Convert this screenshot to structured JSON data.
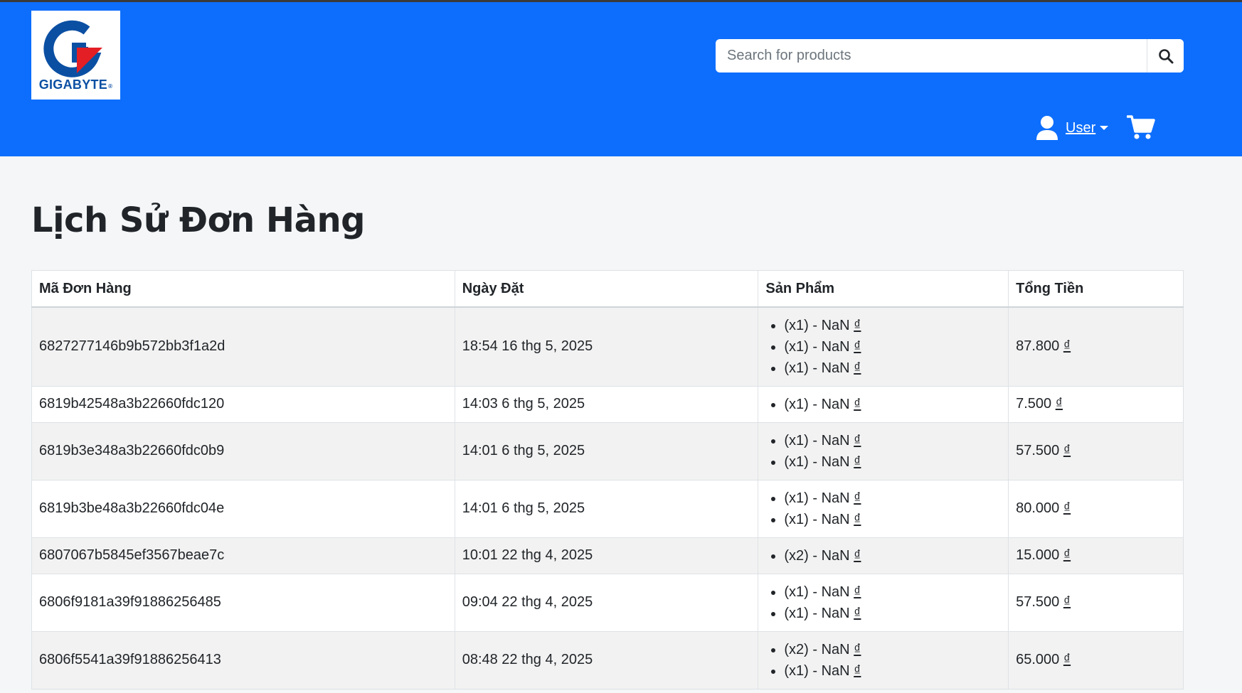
{
  "brand": {
    "logo_text": "GIGABYTE",
    "registered_mark": "®",
    "colors": {
      "header_bg": "#0d6efd",
      "logo_blue": "#0b4fa3",
      "logo_red": "#e31e24"
    }
  },
  "search": {
    "placeholder": "Search for products",
    "value": "",
    "button_icon": "search-icon"
  },
  "user_menu": {
    "icon": "user-icon",
    "label": "User",
    "caret_icon": "caret-down-icon"
  },
  "cart": {
    "icon": "shopping-cart-icon"
  },
  "page": {
    "title": "Lịch Sử Đơn Hàng"
  },
  "orders_table": {
    "headers": [
      "Mã Đơn Hàng",
      "Ngày Đặt",
      "Sản Phẩm",
      "Tổng Tiền"
    ],
    "currency_symbol": "₫",
    "rows": [
      {
        "id": "6827277146b9b572bb3f1a2d",
        "date": "18:54 16 thg 5, 2025",
        "items": [
          {
            "qty": "(x1) - NaN ",
            "price_symbol": "₫"
          },
          {
            "qty": "(x1) - NaN ",
            "price_symbol": "₫"
          },
          {
            "qty": "(x1) - NaN ",
            "price_symbol": "₫"
          }
        ],
        "total": "87.800 "
      },
      {
        "id": "6819b42548a3b22660fdc120",
        "date": "14:03 6 thg 5, 2025",
        "items": [
          {
            "qty": "(x1) - NaN ",
            "price_symbol": "₫"
          }
        ],
        "total": "7.500 "
      },
      {
        "id": "6819b3e348a3b22660fdc0b9",
        "date": "14:01 6 thg 5, 2025",
        "items": [
          {
            "qty": "(x1) - NaN ",
            "price_symbol": "₫"
          },
          {
            "qty": "(x1) - NaN ",
            "price_symbol": "₫"
          }
        ],
        "total": "57.500 "
      },
      {
        "id": "6819b3be48a3b22660fdc04e",
        "date": "14:01 6 thg 5, 2025",
        "items": [
          {
            "qty": "(x1) - NaN ",
            "price_symbol": "₫"
          },
          {
            "qty": "(x1) - NaN ",
            "price_symbol": "₫"
          }
        ],
        "total": "80.000 "
      },
      {
        "id": "6807067b5845ef3567beae7c",
        "date": "10:01 22 thg 4, 2025",
        "items": [
          {
            "qty": "(x2) - NaN ",
            "price_symbol": "₫"
          }
        ],
        "total": "15.000 "
      },
      {
        "id": "6806f9181a39f91886256485",
        "date": "09:04 22 thg 4, 2025",
        "items": [
          {
            "qty": "(x1) - NaN ",
            "price_symbol": "₫"
          },
          {
            "qty": "(x1) - NaN ",
            "price_symbol": "₫"
          }
        ],
        "total": "57.500 "
      },
      {
        "id": "6806f5541a39f91886256413",
        "date": "08:48 22 thg 4, 2025",
        "items": [
          {
            "qty": "(x2) - NaN ",
            "price_symbol": "₫"
          },
          {
            "qty": "(x1) - NaN ",
            "price_symbol": "₫"
          }
        ],
        "total": "65.000 "
      }
    ]
  }
}
